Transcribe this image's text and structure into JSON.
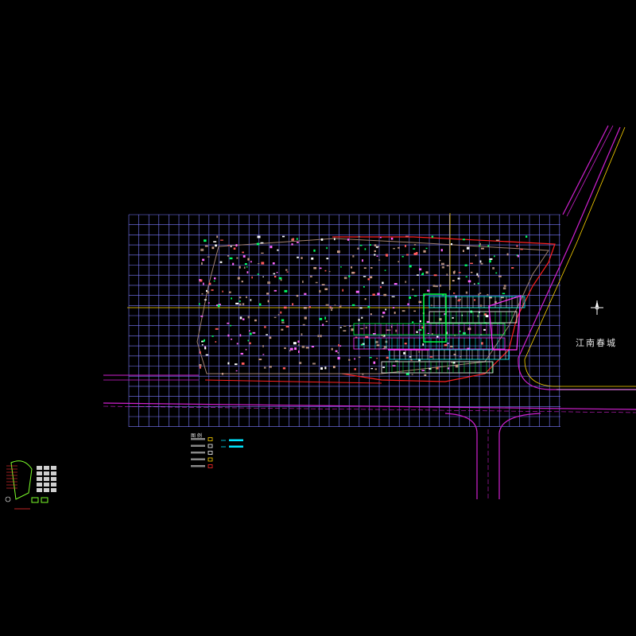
{
  "drawing": {
    "background": "#000000",
    "grid_color": "#7b7bff",
    "road_color": "#d020d0",
    "axis_color": "#ffd400"
  },
  "labels": {
    "road_name": "江南春城",
    "legend_title": "图 例"
  },
  "legend": {
    "rows": [
      {
        "text": "",
        "color": "#ffd400"
      },
      {
        "text": "",
        "color": "#ffffff"
      },
      {
        "text": "",
        "color": "#ffffff"
      },
      {
        "text": "",
        "color": "#ffd400"
      },
      {
        "text": "",
        "color": "#ff2a2a"
      }
    ],
    "extra": [
      {
        "text": "",
        "color": "#00e5ff"
      },
      {
        "text": "",
        "color": "#00e5ff"
      }
    ]
  },
  "icons": {
    "north_arrow": "north-arrow-icon"
  }
}
